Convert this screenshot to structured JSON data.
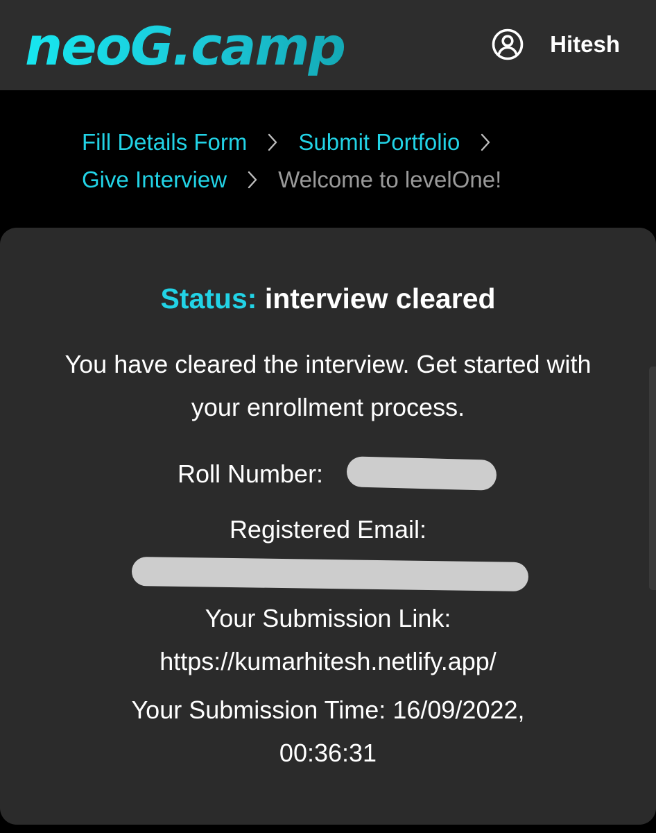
{
  "header": {
    "logo_text": "neoG.camp",
    "user_icon": "user-circle-icon",
    "user_name": "Hitesh"
  },
  "breadcrumb": {
    "items": [
      {
        "label": "Fill Details Form"
      },
      {
        "label": "Submit Portfolio"
      },
      {
        "label": "Give Interview"
      },
      {
        "label": "Welcome to levelOne!"
      }
    ],
    "separator_icon": "chevron-right-icon"
  },
  "card": {
    "status_label": "Status:",
    "status_value": "interview cleared",
    "message": "You have cleared the interview. Get started with your enrollment process.",
    "roll_label": "Roll Number:",
    "email_label": "Registered Email:",
    "submission_link_label": "Your Submission Link:",
    "submission_link": "https://kumarhitesh.netlify.app/",
    "submission_time_label": "Your Submission Time:",
    "submission_time": "16/09/2022, 00:36:31"
  },
  "colors": {
    "accent": "#22d3e6",
    "header_bg": "#2d2d2d",
    "page_bg": "#000000",
    "card_bg": "#2b2b2b",
    "muted_text": "#9a9a9a"
  }
}
